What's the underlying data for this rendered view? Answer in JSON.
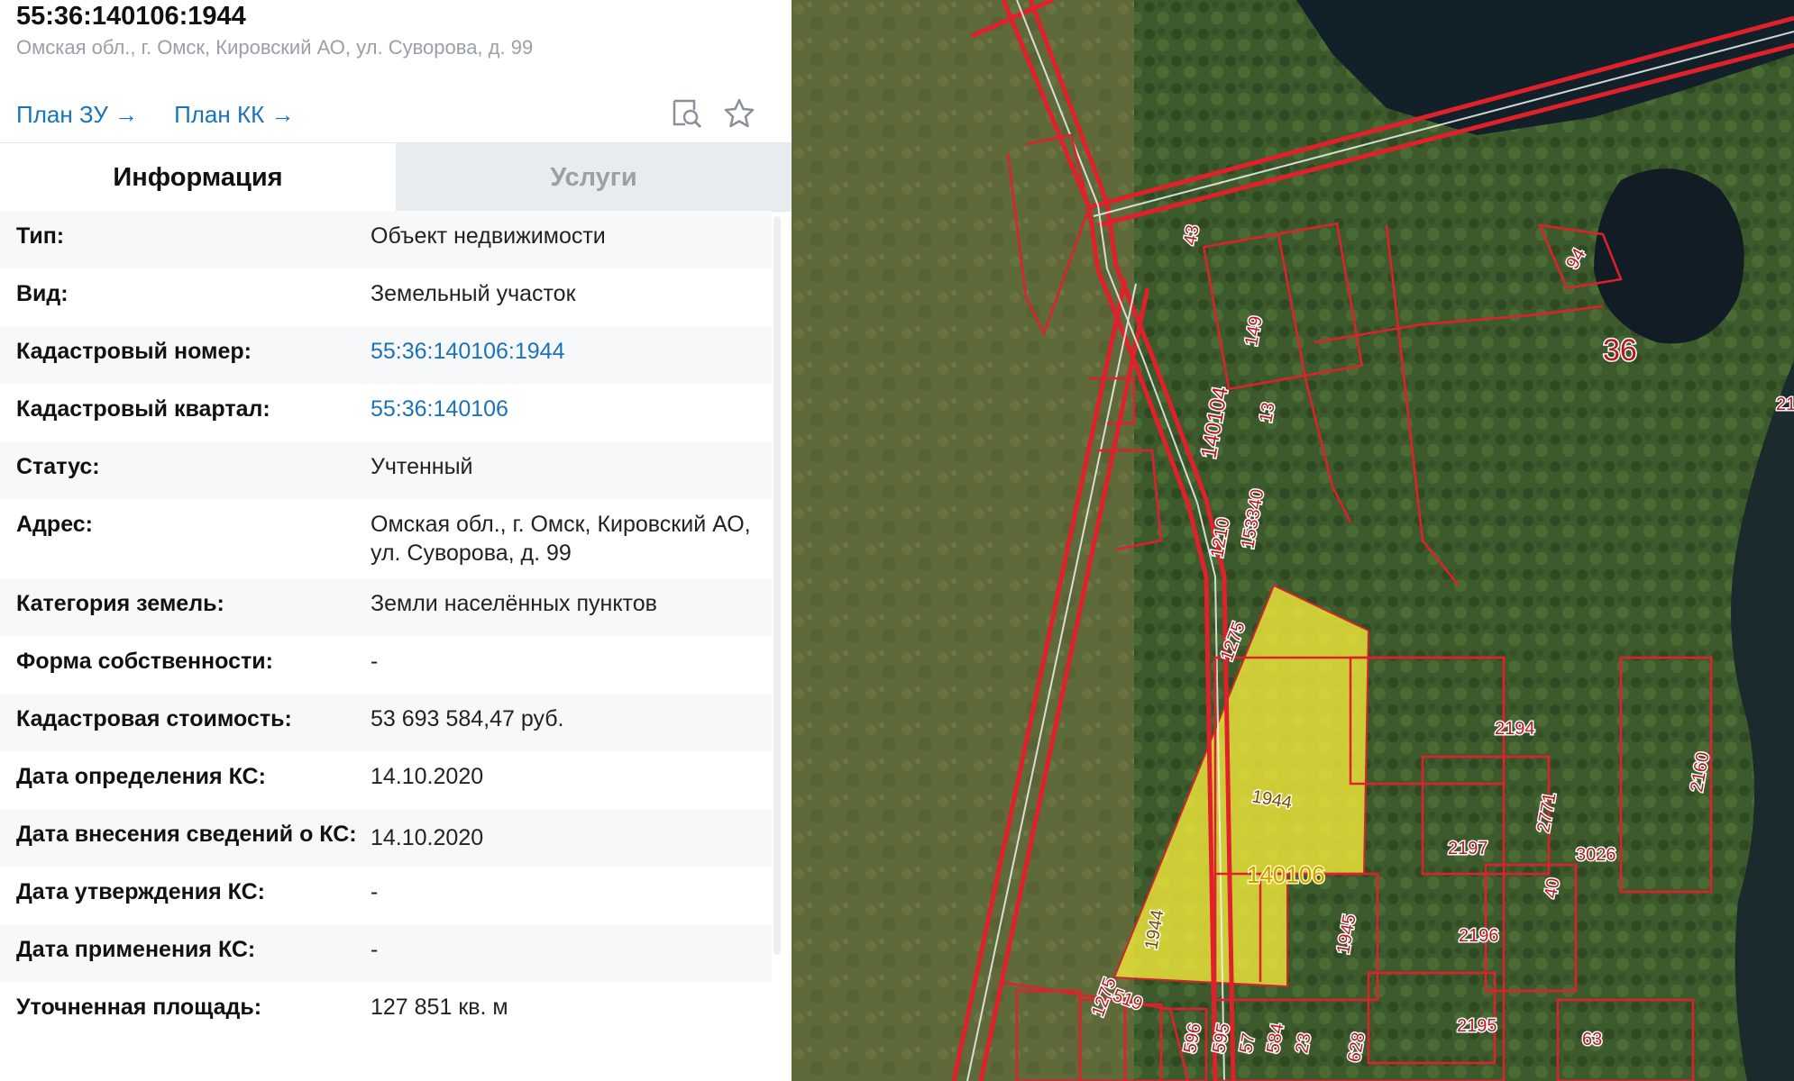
{
  "header": {
    "title": "55:36:140106:1944",
    "address": "Омская обл., г. Омск, Кировский АО, ул. Суворова, д. 99"
  },
  "links": {
    "plan_zu": "План ЗУ →",
    "plan_kk": "План КК →"
  },
  "icons": [
    "search-document-icon",
    "star-icon"
  ],
  "tabs": {
    "info": "Информация",
    "services": "Услуги"
  },
  "properties": [
    {
      "label": "Тип:",
      "value": "Объект недвижимости"
    },
    {
      "label": "Вид:",
      "value": "Земельный участок"
    },
    {
      "label": "Кадастровый номер:",
      "value": "55:36:140106:1944"
    },
    {
      "label": "Кадастровый квартал:",
      "value": "55:36:140106"
    },
    {
      "label": "Статус:",
      "value": "Учтенный"
    },
    {
      "label": "Адрес:",
      "value": "Омская обл., г. Омск, Кировский АО, ул. Суворова, д. 99"
    },
    {
      "label": "Категория земель:",
      "value": "Земли населённых пунктов"
    },
    {
      "label": "Форма собственности:",
      "value": "-"
    },
    {
      "label": "Кадастровая стоимость:",
      "value": "53 693 584,47 руб."
    },
    {
      "label": "Дата определения КС:",
      "value": "14.10.2020"
    },
    {
      "label": "Дата внесения сведений о КС:",
      "value": "14.10.2020"
    },
    {
      "label": "Дата утверждения КС:",
      "value": "-"
    },
    {
      "label": "Дата применения КС:",
      "value": "-"
    },
    {
      "label": "Уточненная площадь:",
      "value": "127 851 кв. м"
    }
  ],
  "map_labels": {
    "l43": "43",
    "l149": "149",
    "l140104": "140104",
    "l13": "13",
    "l153340": "153340",
    "l1210": "1210",
    "l1275a": "1275",
    "l1275b": "1275",
    "l1944a": "1944",
    "l1944b": "1944",
    "l140106": "140106",
    "l1945": "1945",
    "l519": "519",
    "l596": "596",
    "l595": "595",
    "l57": "57",
    "l584": "584",
    "l23": "23",
    "l628": "628",
    "l94": "94",
    "l36": "36",
    "l21": "21",
    "l2194": "2194",
    "l2771": "2771",
    "l2160": "2160",
    "l2197": "2197",
    "l3026": "3026",
    "l40": "40",
    "l2196": "2196",
    "l2195": "2195",
    "l63": "63"
  },
  "colors": {
    "link": "#1a73b8",
    "parcel_border": "#e0202a",
    "selected_parcel": "#e8e23a",
    "tab_inactive_bg": "#e9ecef"
  }
}
